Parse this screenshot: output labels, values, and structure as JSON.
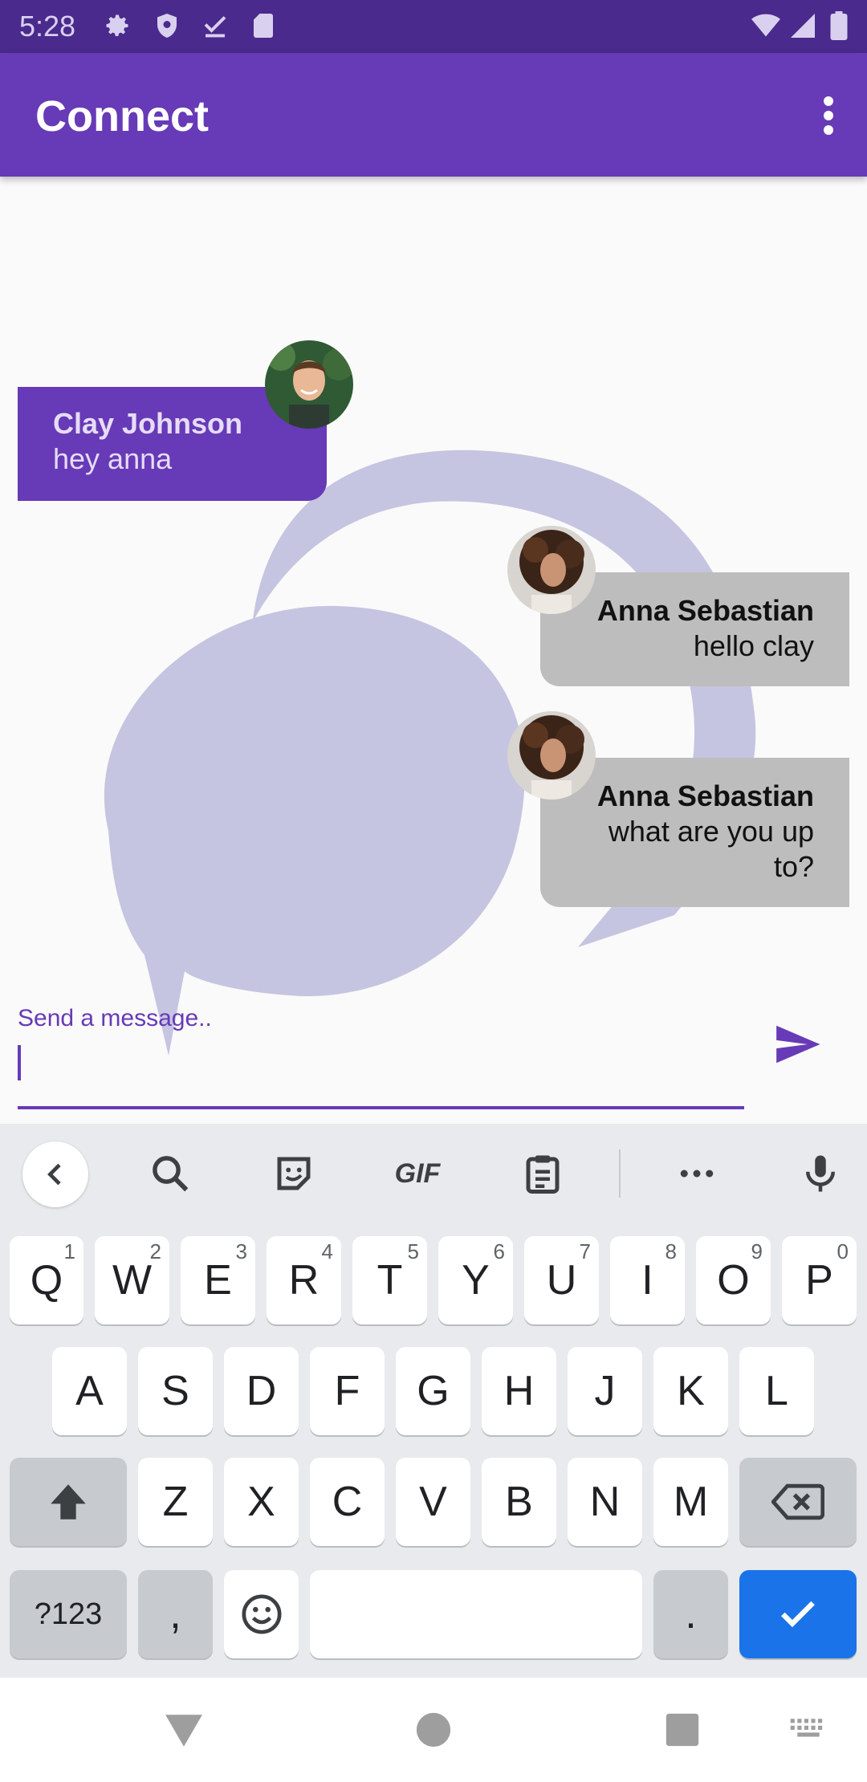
{
  "status_bar": {
    "time": "5:28"
  },
  "app_bar": {
    "title": "Connect"
  },
  "messages": [
    {
      "sender": "Clay Johnson",
      "text": "hey anna",
      "side": "left"
    },
    {
      "sender": "Anna Sebastian",
      "text": "hello clay",
      "side": "right"
    },
    {
      "sender": "Anna Sebastian",
      "text": "what are you up to?",
      "side": "right"
    }
  ],
  "composer": {
    "label": "Send a message..",
    "value": ""
  },
  "keyboard": {
    "row1": [
      {
        "key": "Q",
        "hint": "1"
      },
      {
        "key": "W",
        "hint": "2"
      },
      {
        "key": "E",
        "hint": "3"
      },
      {
        "key": "R",
        "hint": "4"
      },
      {
        "key": "T",
        "hint": "5"
      },
      {
        "key": "Y",
        "hint": "6"
      },
      {
        "key": "U",
        "hint": "7"
      },
      {
        "key": "I",
        "hint": "8"
      },
      {
        "key": "O",
        "hint": "9"
      },
      {
        "key": "P",
        "hint": "0"
      }
    ],
    "row2": [
      "A",
      "S",
      "D",
      "F",
      "G",
      "H",
      "J",
      "K",
      "L"
    ],
    "row3": [
      "Z",
      "X",
      "C",
      "V",
      "B",
      "N",
      "M"
    ],
    "symbols_label": "?123",
    "comma": ",",
    "period": ".",
    "toolbar_gif": "GIF"
  },
  "colors": {
    "primary": "#673ab7",
    "statusbar": "#4a2a8c",
    "incoming_bubble": "#bdbdbd",
    "logo_tint": "#c5c5e1",
    "enter_key": "#1a73e8"
  }
}
